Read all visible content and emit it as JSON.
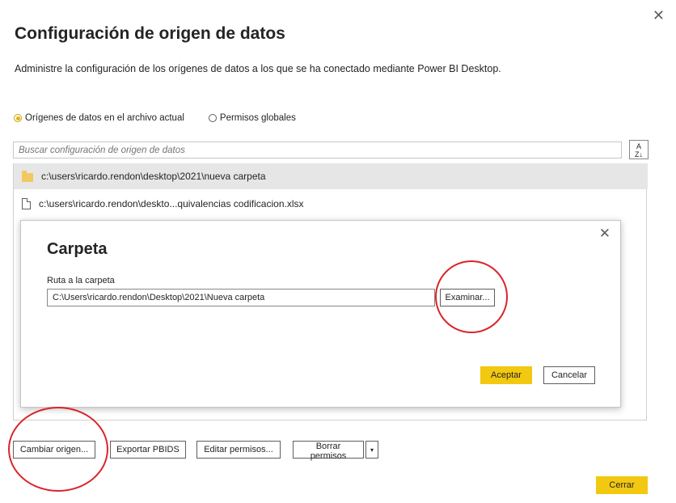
{
  "window": {
    "close_glyph": "✕"
  },
  "header": {
    "title": "Configuración de origen de datos",
    "subtitle": "Administre la configuración de los orígenes de datos a los que se ha conectado mediante Power BI Desktop."
  },
  "scope": {
    "options": [
      {
        "label": "Orígenes de datos en el archivo actual",
        "selected": true
      },
      {
        "label": "Permisos globales",
        "selected": false
      }
    ]
  },
  "search": {
    "placeholder": "Buscar configuración de origen de datos",
    "value": ""
  },
  "sort": {
    "icon": "sort-az-icon",
    "glyph_top": "A",
    "glyph_bottom": "Z↓"
  },
  "sources": [
    {
      "icon": "folder-icon",
      "path": "c:\\users\\ricardo.rendon\\desktop\\2021\\nueva carpeta",
      "selected": true
    },
    {
      "icon": "file-icon",
      "path": "c:\\users\\ricardo.rendon\\deskto...quivalencias codificacion.xlsx",
      "selected": false
    }
  ],
  "folder_dialog": {
    "title": "Carpeta",
    "close_glyph": "✕",
    "field_label": "Ruta a la carpeta",
    "field_value": "C:\\Users\\ricardo.rendon\\Desktop\\2021\\Nueva carpeta",
    "browse_label": "Examinar...",
    "ok_label": "Aceptar",
    "cancel_label": "Cancelar"
  },
  "actions": {
    "change_source": "Cambiar origen...",
    "export_pbids": "Exportar PBIDS",
    "edit_permissions": "Editar permisos...",
    "delete_permissions": "Borrar permisos",
    "dropdown_glyph": "▾"
  },
  "footer": {
    "close_label": "Cerrar"
  },
  "colors": {
    "accent": "#f2c811",
    "annotation": "#d8262b",
    "selected_row": "#e6e6e6"
  }
}
